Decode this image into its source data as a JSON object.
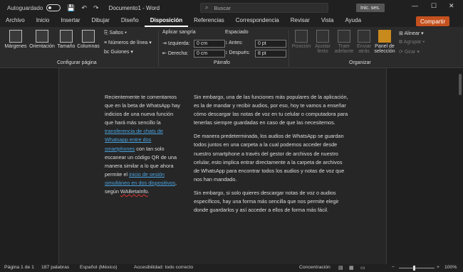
{
  "titlebar": {
    "autosave": "Autoguardado",
    "doc_title": "Documento1 - Word",
    "search_placeholder": "Buscar",
    "signin": "Inic. ses.",
    "qa_save": "💾",
    "qa_undo": "↶",
    "qa_redo": "↷",
    "min": "—",
    "max": "☐",
    "close": "✕"
  },
  "tabs": [
    "Archivo",
    "Inicio",
    "Insertar",
    "Dibujar",
    "Diseño",
    "Disposición",
    "Referencias",
    "Correspondencia",
    "Revisar",
    "Vista",
    "Ayuda"
  ],
  "share": "Compartir",
  "ribbon": {
    "margins": "Márgenes",
    "orientation": "Orientación",
    "size": "Tamaño",
    "columns": "Columnas",
    "breaks": "Saltos",
    "line_numbers": "Números de línea",
    "hyphenation": "Guiones",
    "group_page": "Configurar página",
    "indent_title": "Aplicar sangría",
    "spacing_title": "Espaciado",
    "left_label": "Izquierda:",
    "right_label": "Derecha:",
    "before_label": "Antes:",
    "after_label": "Después:",
    "left_val": "0 cm",
    "right_val": "0 cm",
    "before_val": "0 pt",
    "after_val": "8 pt",
    "group_paragraph": "Párrafo",
    "position": "Posición",
    "wrap": "Ajustar texto",
    "bring_forward": "Traer adelante",
    "send_backward": "Enviar atrás",
    "selection_pane": "Panel de selección",
    "align": "Alinear",
    "group": "Agrupar",
    "rotate": "Girar",
    "group_arrange": "Organizar"
  },
  "document": {
    "col1_a": "Recientemente te comentamos que en la beta de WhatsApp hay indicios de una nueva función que hará más sencillo la ",
    "col1_link1": "transferencia de chats de Whatsapp entre dos smartphones",
    "col1_b": " con tan solo escanear un código QR de una manera similar a lo que ahora permite el ",
    "col1_link2": "inicio de sesión simultáneo en dos dispositivos",
    "col1_c": ", según ",
    "col1_d": "WABetaInfo",
    "col1_e": ".",
    "p1": "Sin embargo, una de las funciones más populares de la aplicación, es la de mandar y recibir audios, por eso, hoy te vamos a enseñar cómo descargar las notas de voz en tu celular o computadora para tenerlas siempre guardadas en caso de que las necesitemos.",
    "p2": "De manera predeterminada, los audios de WhatsApp se guardan todos juntos en una carpeta a la cual podemos acceder desde nuestro smartphone a través del gestor de archivos de nuestro celular, esto implica entrar directamente a la carpeta de archivos de WhatsApp para encontrar todos los audios y notas de voz que nos han mandado.",
    "p3": "Sin embargo, si solo quieres descargar notas de voz o audios específicos, hay una forma más sencilla que nos permite elegir donde guardarlos y así acceder a ellos de forma más fácil."
  },
  "status": {
    "page": "Página 1 de 1",
    "words": "187 palabras",
    "lang": "Español (México)",
    "accessibility": "Accesibilidad: todo correcto",
    "focus": "Concentración",
    "zoom": "100%"
  },
  "zoom_level": 1.0
}
